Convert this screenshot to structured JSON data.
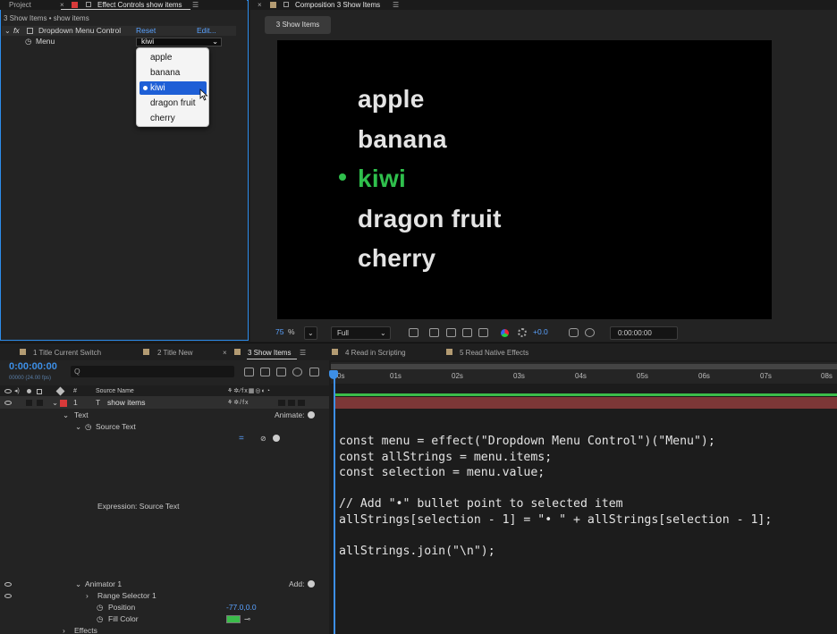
{
  "effect_controls": {
    "tabs": {
      "project": "Project",
      "effect_controls": "Effect Controls show items"
    },
    "subtitle": "3 Show Items • show items",
    "fx_label": "fx",
    "effect_name": "Dropdown Menu Control",
    "reset": "Reset",
    "edit": "Edit...",
    "menu_label": "Menu",
    "selected_value": "kiwi",
    "options": [
      "apple",
      "banana",
      "kiwi",
      "dragon fruit",
      "cherry"
    ],
    "selected_index": 2
  },
  "composition": {
    "tab_title": "Composition 3 Show Items",
    "chip": "3 Show Items",
    "lines": [
      "apple",
      "banana",
      "kiwi",
      "dragon fruit",
      "cherry"
    ],
    "highlight_color": "#2fbf4c",
    "zoom": "75",
    "zoom_unit": "%",
    "resolution": "Full",
    "exposure": "+0.0",
    "timecode": "0:00:00:00"
  },
  "timeline": {
    "tabs": [
      "1 Title Current Switch",
      "2 Title New",
      "3 Show Items",
      "4 Read in Scripting",
      "5 Read Native Effects"
    ],
    "active_tab": "3 Show Items",
    "timecode": "0:00:00:00",
    "fps": "00000 (24.00 fps)",
    "search_placeholder": "Q",
    "ruler": [
      "0s",
      "01s",
      "02s",
      "03s",
      "04s",
      "05s",
      "06s",
      "07s",
      "08s"
    ],
    "col_hash": "#",
    "col_source_name": "Source Name",
    "layer_number": "1",
    "layer_type": "T",
    "layer_name": "show items",
    "text_label": "Text",
    "animate_label": "Animate:",
    "source_text_label": "Source Text",
    "expr_equals": "=",
    "expression_label": "Expression: Source Text",
    "animator_label": "Animator 1",
    "add_label": "Add:",
    "range_selector_label": "Range Selector 1",
    "position_label": "Position",
    "position_value": "-77.0,0.0",
    "fill_color_label": "Fill Color",
    "fill_color": "#3bbd4a",
    "effects_label": "Effects"
  },
  "expression_code": [
    "const menu = effect(\"Dropdown Menu Control\")(\"Menu\");",
    "const allStrings = menu.items;",
    "const selection = menu.value;",
    "",
    "// Add \"•\" bullet point to selected item",
    "allStrings[selection - 1] = \"• \" + allStrings[selection - 1];",
    "",
    "allStrings.join(\"\\n\");"
  ]
}
